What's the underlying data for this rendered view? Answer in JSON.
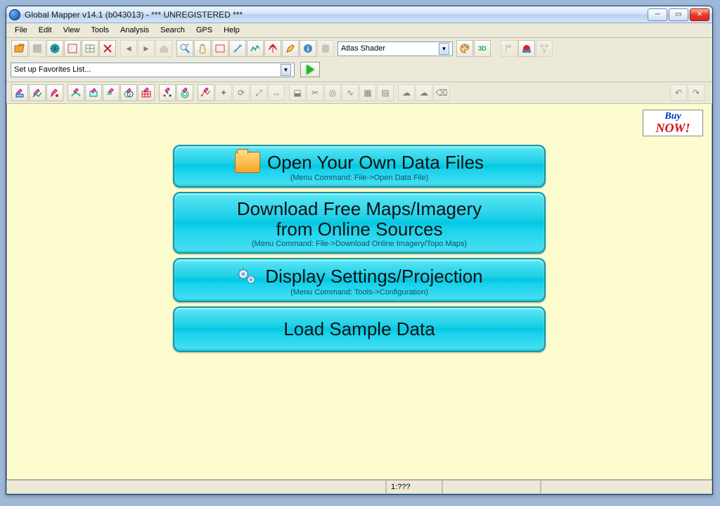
{
  "title": "Global Mapper v14.1 (b043013) - *** UNREGISTERED ***",
  "menu": [
    "File",
    "Edit",
    "View",
    "Tools",
    "Analysis",
    "Search",
    "GPS",
    "Help"
  ],
  "shader": "Atlas Shader",
  "favorites_placeholder": "Set up Favorites List...",
  "buy_now": {
    "line1": "Buy",
    "line2": "NOW!"
  },
  "start": {
    "open": {
      "title": "Open Your Own Data Files",
      "sub": "(Menu Command: File->Open Data File)"
    },
    "download": {
      "title1": "Download Free Maps/Imagery",
      "title2": "from Online Sources",
      "sub": "(Menu Command: File->Download Online Imagery/Topo Maps)"
    },
    "config": {
      "title": "Display Settings/Projection",
      "sub": "(Menu Command: Tools->Configuration)"
    },
    "sample": {
      "title": "Load Sample Data"
    }
  },
  "status": {
    "scale": "1:???"
  },
  "icons": {
    "folder": "folder-open-icon",
    "grey": "disabled-icon",
    "globe": "globe-icon",
    "layers": "layers-icon",
    "tree": "tree-icon",
    "rect": "rect-icon",
    "cross": "cross-icon",
    "arrowL": "arrow-left-icon",
    "arrowR": "arrow-right-icon",
    "home": "home-icon",
    "zoom": "magnify-icon",
    "hand": "hand-icon",
    "grid": "grid-icon",
    "chartpin": "pin-icon",
    "chart": "chart-icon",
    "tower": "antenna-icon",
    "pen": "pencil-icon",
    "info": "info-icon",
    "cyl": "cylinder-icon",
    "pal": "palette-icon",
    "threeD": "3d-icon",
    "flag": "flag-icon",
    "cd": "disc-icon",
    "net": "network-icon",
    "dig": "digitize-icon"
  }
}
